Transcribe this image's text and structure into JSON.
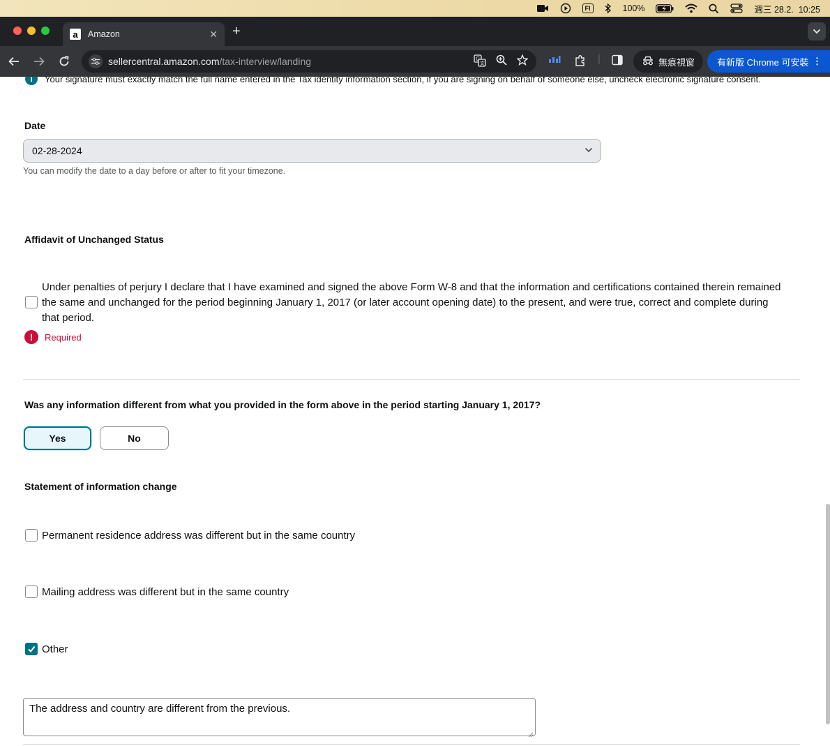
{
  "menubar": {
    "battery": "100%",
    "input_method": "FI",
    "datetime": "週三 28.2.  10:25"
  },
  "browser": {
    "tab_title": "Amazon",
    "favicon_letter": "a",
    "url_host": "sellercentral.amazon.com",
    "url_path": "/tax-interview/landing",
    "incognito_label": "無痕視窗",
    "update_label": "有新版 Chrome 可安裝"
  },
  "page": {
    "signature_note": "Your signature must exactly match the full name entered in the Tax identity information section, if you are signing on behalf of someone else, uncheck electronic signature consent.",
    "date_label": "Date",
    "date_value": "02-28-2024",
    "date_hint": "You can modify the date to a day before or after to fit your timezone.",
    "affidavit_heading": "Affidavit of Unchanged Status",
    "affidavit_text": "Under penalties of perjury I declare that I have examined and signed the above Form W-8 and that the information and certifications contained therein remained the same and unchanged for the period beginning January 1, 2017 (or later account opening date) to the present, and were true, correct and complete during that period.",
    "affidavit_checked": false,
    "required_text": "Required",
    "question": "Was any information different from what you provided in the form above in the period starting January 1, 2017?",
    "yes_label": "Yes",
    "no_label": "No",
    "selected_answer": "Yes",
    "statement_heading": "Statement of information change",
    "options": [
      {
        "label": "Permanent residence address was different but in the same country",
        "checked": false
      },
      {
        "label": "Mailing address was different but in the same country",
        "checked": false
      },
      {
        "label": "Other",
        "checked": true
      }
    ],
    "other_text": "The address and country are different from the previous."
  },
  "colors": {
    "accent": "#007185",
    "error": "#cc0c39",
    "update_button": "#0b57d0"
  }
}
